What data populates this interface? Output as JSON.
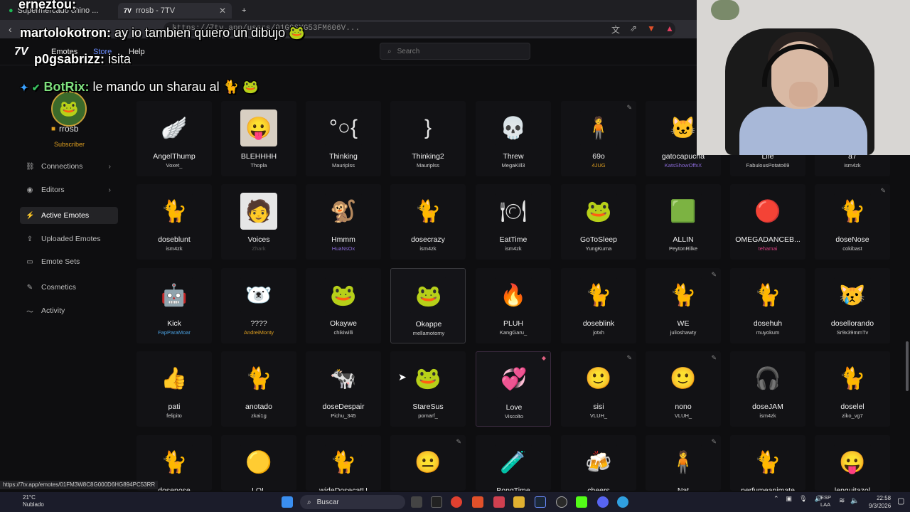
{
  "browser": {
    "tabs": [
      {
        "label": "Supermercado chino ...",
        "active": false
      },
      {
        "label": "rrosb - 7TV",
        "active": true
      }
    ],
    "new_tab": "+",
    "address": "https://7tv.app/users/01G9SYG53FM606V..."
  },
  "site": {
    "logo": "7V",
    "nav": [
      "Emotes",
      "Store",
      "Help"
    ],
    "search_placeholder": "Search"
  },
  "profile": {
    "username": "rrosb",
    "badge": "Subscriber"
  },
  "sidebar": {
    "items": [
      {
        "label": "Connections",
        "icon": "link-icon",
        "chevron": true,
        "active": false
      },
      {
        "label": "Editors",
        "icon": "user-circle-icon",
        "chevron": true,
        "active": false
      },
      {
        "label": "Active Emotes",
        "icon": "bolt-icon",
        "chevron": false,
        "active": true
      },
      {
        "label": "Uploaded Emotes",
        "icon": "upload-icon",
        "chevron": false,
        "active": false
      },
      {
        "label": "Emote Sets",
        "icon": "folder-icon",
        "chevron": false,
        "active": false
      },
      {
        "label": "Cosmetics",
        "icon": "brush-icon",
        "chevron": false,
        "active": false
      },
      {
        "label": "Activity",
        "icon": "activity-icon",
        "chevron": false,
        "active": false
      }
    ]
  },
  "emotes": [
    [
      {
        "name": "AngelThump",
        "author": "Voxet_",
        "glyph": "🪽",
        "bg": "#121215",
        "author_color": "#cfcfcf"
      },
      {
        "name": "BLEHHHH",
        "author": "Thopla",
        "glyph": "😛",
        "bg": "#d8cfc2",
        "author_color": "#cfcfcf"
      },
      {
        "name": "Thinking",
        "author": "Mauriplss",
        "glyph": "°○{",
        "bg": "#121215",
        "author_color": "#cfcfcf"
      },
      {
        "name": "Thinking2",
        "author": "Mauriplss",
        "glyph": "}",
        "bg": "#121215",
        "author_color": "#cfcfcf"
      },
      {
        "name": "Threw",
        "author": "MegaKill3",
        "glyph": "💀",
        "bg": "#121215",
        "author_color": "#cfcfcf"
      },
      {
        "name": "69o",
        "author": "4JUG",
        "glyph": "🧍",
        "bg": "#121215",
        "author_color": "#e0a020",
        "edit": true
      },
      {
        "name": "gatocapucha",
        "author": "KatsShowOffxX",
        "glyph": "🐱",
        "bg": "#121215",
        "author_color": "#8a6ad8"
      },
      {
        "name": "Life",
        "author": "FabulousPotato69",
        "glyph": "🌱",
        "bg": "#121215",
        "author_color": "#cfcfcf"
      },
      {
        "name": "a7",
        "author": "ism4zk",
        "glyph": "🔹",
        "bg": "#121215",
        "author_color": "#cfcfcf"
      }
    ],
    [
      {
        "name": "doseblunt",
        "author": "ism4zk",
        "glyph": "🐈",
        "bg": "#121215",
        "author_color": "#cfcfcf"
      },
      {
        "name": "Voices",
        "author": "Zhark",
        "glyph": "🧑",
        "bg": "#e6e6e6",
        "author_color": "#555"
      },
      {
        "name": "Hmmm",
        "author": "HuaNsOx",
        "glyph": "🐒",
        "bg": "#121215",
        "author_color": "#8a6ad8"
      },
      {
        "name": "dosecrazy",
        "author": "ism4zk",
        "glyph": "🐈",
        "bg": "#121215",
        "author_color": "#cfcfcf"
      },
      {
        "name": "EatTime",
        "author": "ism4zk",
        "glyph": "🍽",
        "bg": "#121215",
        "author_color": "#cfcfcf"
      },
      {
        "name": "GoToSleep",
        "author": "YungKuma",
        "glyph": "🐸",
        "bg": "#121215",
        "author_color": "#cfcfcf"
      },
      {
        "name": "ALLIN",
        "author": "PeytonRilke",
        "glyph": "🟩",
        "bg": "#121215",
        "author_color": "#cfcfcf"
      },
      {
        "name": "OMEGADANCEB...",
        "author": "tehamai",
        "glyph": "🔴",
        "bg": "#121215",
        "author_color": "#d84080"
      },
      {
        "name": "doseNose",
        "author": "cokibast",
        "glyph": "🐈",
        "bg": "#121215",
        "author_color": "#cfcfcf",
        "edit": true
      }
    ],
    [
      {
        "name": "Kick",
        "author": "FapParaMoar",
        "glyph": "🤖",
        "bg": "#121215",
        "author_color": "#4aa0e0"
      },
      {
        "name": "????",
        "author": "AndreiMonty",
        "glyph": "🐻‍❄️",
        "bg": "#121215",
        "author_color": "#e0a020"
      },
      {
        "name": "Okaywe",
        "author": "chikiwilli",
        "glyph": "🐸",
        "bg": "#121215",
        "author_color": "#cfcfcf"
      },
      {
        "name": "Okappe",
        "author": "mellamotomy",
        "glyph": "🐸",
        "bg": "#141418",
        "author_color": "#cfcfcf",
        "highlight": true
      },
      {
        "name": "PLUH",
        "author": "KangGaru_",
        "glyph": "🔥",
        "bg": "#121215",
        "author_color": "#cfcfcf"
      },
      {
        "name": "doseblink",
        "author": "jotxh",
        "glyph": "🐈",
        "bg": "#121215",
        "author_color": "#cfcfcf"
      },
      {
        "name": "WE",
        "author": "julioshawty",
        "glyph": "🐈",
        "bg": "#121215",
        "author_color": "#cfcfcf",
        "edit": true
      },
      {
        "name": "dosehuh",
        "author": "muyokum",
        "glyph": "🐈",
        "bg": "#121215",
        "author_color": "#cfcfcf"
      },
      {
        "name": "dosellorando",
        "author": "Sr9x39mmTv",
        "glyph": "😿",
        "bg": "#121215",
        "author_color": "#cfcfcf"
      }
    ],
    [
      {
        "name": "pati",
        "author": "felipito",
        "glyph": "👍",
        "bg": "#121215",
        "author_color": "#cfcfcf"
      },
      {
        "name": "anotado",
        "author": "zkai1g",
        "glyph": "🐈",
        "bg": "#121215",
        "author_color": "#cfcfcf"
      },
      {
        "name": "doseDespair",
        "author": "Pichu_345",
        "glyph": "🐄",
        "bg": "#121215",
        "author_color": "#cfcfcf"
      },
      {
        "name": "StareSus",
        "author": "pomarf_",
        "glyph": "🐸",
        "bg": "#121215",
        "author_color": "#cfcfcf"
      },
      {
        "name": "Love",
        "author": "Viscolto",
        "glyph": "💞",
        "bg": "#141418",
        "author_color": "#cfcfcf",
        "highlight2": true
      },
      {
        "name": "sisi",
        "author": "VLUH_",
        "glyph": "🙂",
        "bg": "#121215",
        "author_color": "#cfcfcf",
        "edit": true
      },
      {
        "name": "nono",
        "author": "VLUH_",
        "glyph": "🙂",
        "bg": "#121215",
        "author_color": "#cfcfcf",
        "edit": true
      },
      {
        "name": "doseJAM",
        "author": "ism4zk",
        "glyph": "🎧",
        "bg": "#121215",
        "author_color": "#cfcfcf"
      },
      {
        "name": "doselel",
        "author": "ziko_vg7",
        "glyph": "🐈",
        "bg": "#121215",
        "author_color": "#cfcfcf"
      }
    ],
    [
      {
        "name": "dosenose",
        "author": "",
        "glyph": "🐈",
        "bg": "#121215",
        "author_color": "#cfcfcf"
      },
      {
        "name": "LOL",
        "author": "",
        "glyph": "🟡",
        "bg": "#121215",
        "author_color": "#cfcfcf"
      },
      {
        "name": "wideDosecatU",
        "author": "",
        "glyph": "🐈",
        "bg": "#121215",
        "author_color": "#cfcfcf"
      },
      {
        "name": "",
        "author": "",
        "glyph": "😐",
        "bg": "#121215",
        "author_color": "#cfcfcf",
        "edit": true
      },
      {
        "name": "BongTime",
        "author": "",
        "glyph": "🧪",
        "bg": "#121215",
        "author_color": "#cfcfcf"
      },
      {
        "name": "cheers",
        "author": "",
        "glyph": "🍻",
        "bg": "#121215",
        "author_color": "#cfcfcf"
      },
      {
        "name": "Nat",
        "author": "",
        "glyph": "🧍",
        "bg": "#121215",
        "author_color": "#cfcfcf",
        "edit": true
      },
      {
        "name": "perfumeanimate",
        "author": "",
        "glyph": "🐈",
        "bg": "#121215",
        "author_color": "#cfcfcf"
      },
      {
        "name": "lenguitazol",
        "author": "",
        "glyph": "😛",
        "bg": "#121215",
        "author_color": "#cfcfcf"
      }
    ]
  ],
  "chat": [
    {
      "user": "erneztou:",
      "msg": "",
      "color": "#ffffff"
    },
    {
      "user": "martolokotron:",
      "msg": "ay io tambien quiero un dibujo",
      "color": "#ffffff"
    },
    {
      "user": "p0gsabrizz:",
      "msg": "isita",
      "color": "#ffffff"
    },
    {
      "user": "BotRix:",
      "msg": "le mando un sharau al",
      "color": "#7ee07e"
    }
  ],
  "status_url": "https://7tv.app/emotes/01FM3W8C8G000D6HG894PC53RR",
  "taskbar": {
    "weather_temp": "21°C",
    "weather_desc": "Nublado",
    "search": "Buscar",
    "lang_1": "ESP",
    "lang_2": "LAA",
    "time": "22:58",
    "date": "9/3/2026"
  }
}
